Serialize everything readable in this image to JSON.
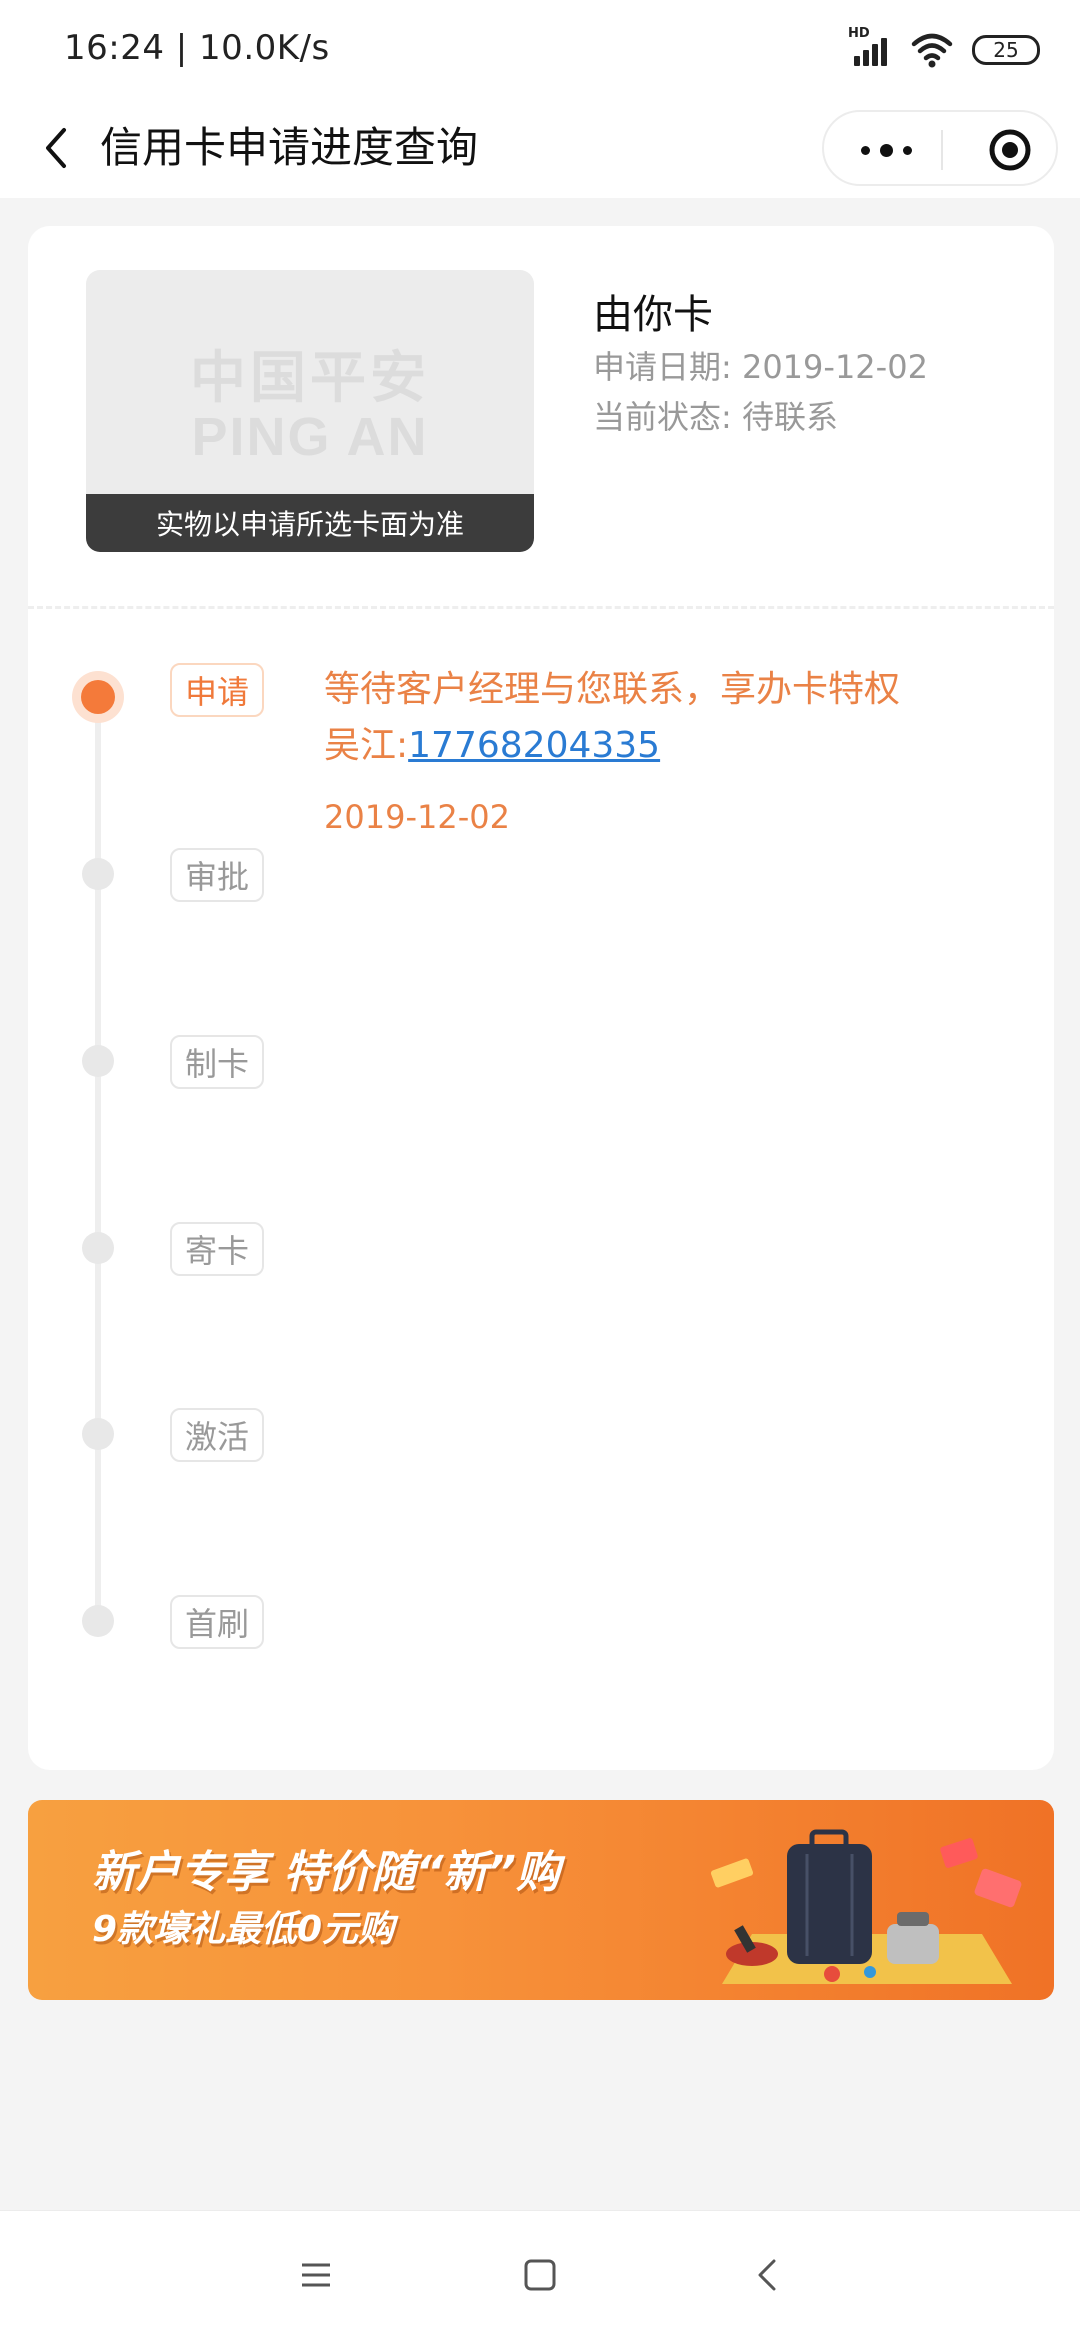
{
  "status_bar": {
    "time": "16:24 | 10.0K/s",
    "hd_label": "HD",
    "battery": "25"
  },
  "nav": {
    "title": "信用卡申请进度查询"
  },
  "card": {
    "name": "由你卡",
    "logo_cn": "中国平安",
    "logo_en": "PING AN",
    "image_caption": "实物以申请所选卡面为准",
    "apply_date_label": "申请日期: 2019-12-02",
    "status_label": "当前状态: 待联系"
  },
  "timeline": {
    "steps": [
      {
        "label": "申请",
        "active": true
      },
      {
        "label": "审批",
        "active": false
      },
      {
        "label": "制卡",
        "active": false
      },
      {
        "label": "寄卡",
        "active": false
      },
      {
        "label": "激活",
        "active": false
      },
      {
        "label": "首刷",
        "active": false
      }
    ],
    "current": {
      "message": "等待客户经理与您联系，享办卡特权",
      "contact_name": "吴江:",
      "contact_phone": "17768204335",
      "date": "2019-12-02"
    }
  },
  "banner": {
    "line1": "新户专享 特价随“新”购",
    "line2": "9款壕礼最低0元购"
  },
  "colors": {
    "accent": "#f47a3a",
    "link": "#2a7bd3",
    "muted": "#999999"
  }
}
